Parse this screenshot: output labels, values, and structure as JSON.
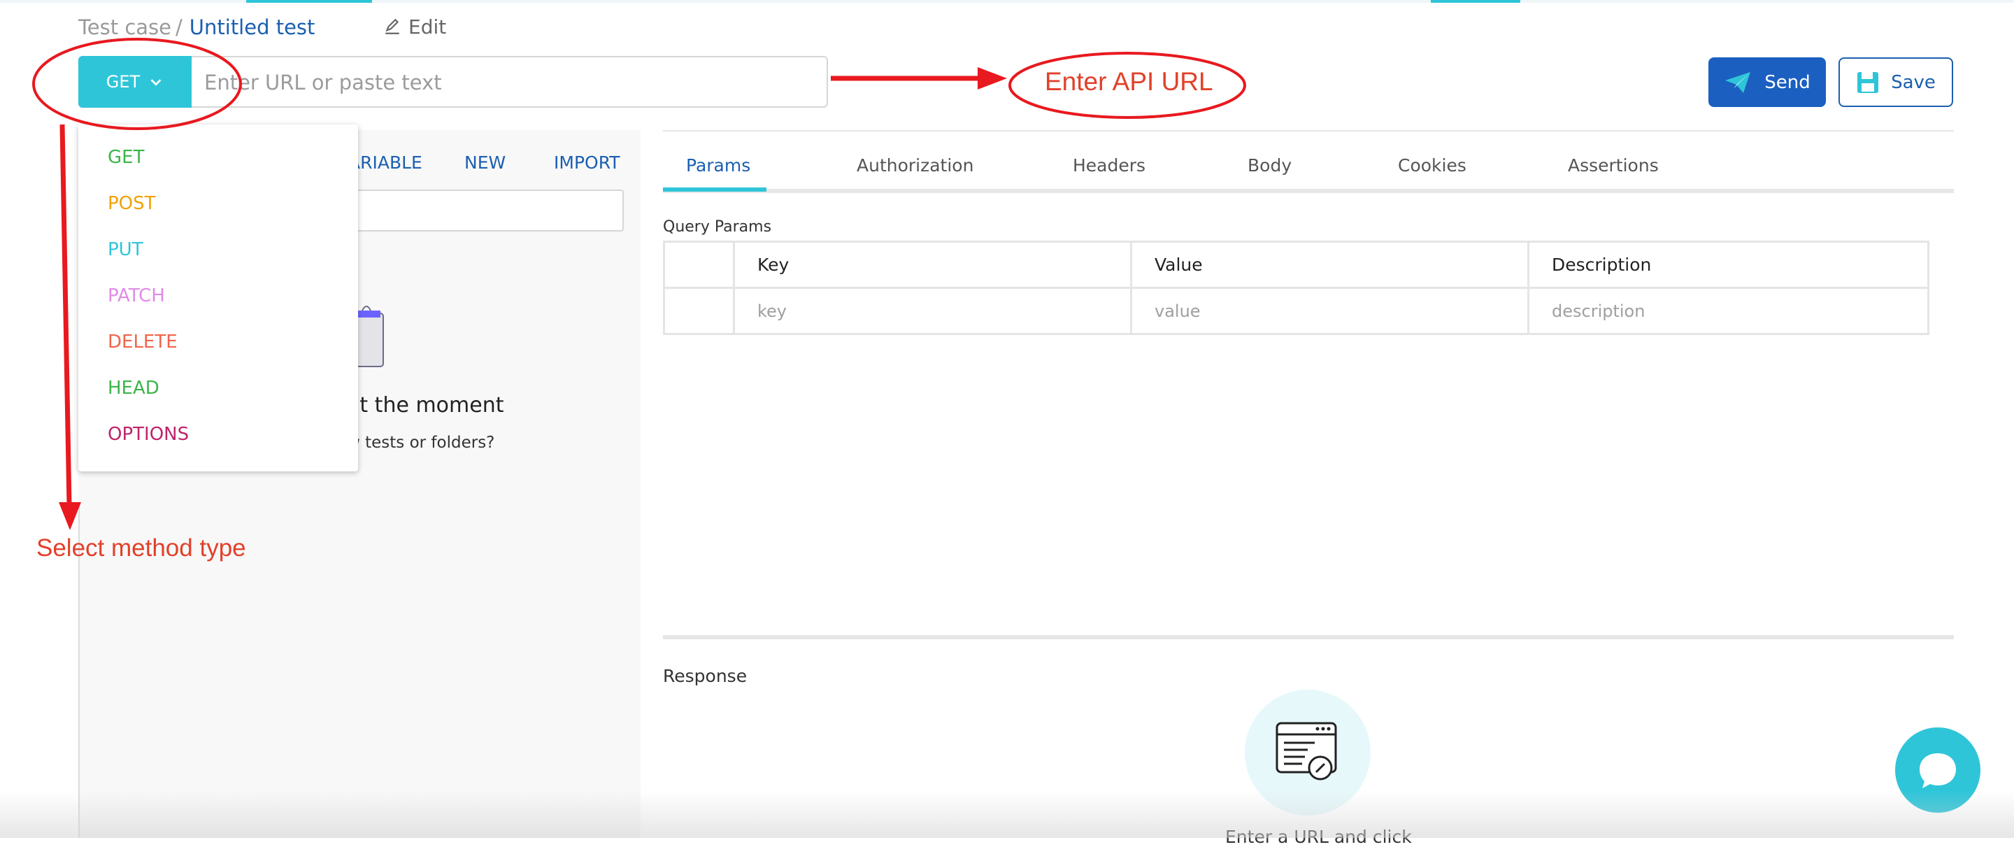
{
  "breadcrumb": {
    "root": "Test case",
    "separator": "/",
    "current": "Untitled test"
  },
  "edit_label": "Edit",
  "request": {
    "method": "GET",
    "url_placeholder": "Enter URL or paste text",
    "send_label": "Send",
    "save_label": "Save"
  },
  "method_menu": [
    {
      "label": "GET",
      "color": "#3bb54a"
    },
    {
      "label": "POST",
      "color": "#f1a20a"
    },
    {
      "label": "PUT",
      "color": "#2ec5d8"
    },
    {
      "label": "PATCH",
      "color": "#e08be6"
    },
    {
      "label": "DELETE",
      "color": "#f2644a"
    },
    {
      "label": "HEAD",
      "color": "#3bb54a"
    },
    {
      "label": "OPTIONS",
      "color": "#c0246a"
    }
  ],
  "left_panel": {
    "tabs": [
      "ARIABLE",
      "NEW",
      "IMPORT"
    ],
    "empty_title": "at the moment",
    "empty_subtitle": "w tests or folders?"
  },
  "tabs": [
    "Params",
    "Authorization",
    "Headers",
    "Body",
    "Cookies",
    "Assertions"
  ],
  "active_tab": "Params",
  "params": {
    "section_label": "Query Params",
    "columns": [
      "Key",
      "Value",
      "Description"
    ],
    "row_placeholders": [
      "key",
      "value",
      "description"
    ]
  },
  "response": {
    "label": "Response",
    "hint": "Enter a URL and click"
  },
  "annotations": {
    "url_callout": "Enter API URL",
    "method_callout": "Select method type",
    "color": "#e2402a"
  },
  "colors": {
    "accent": "#2ec5d8",
    "brand_blue": "#1b5fb0"
  }
}
